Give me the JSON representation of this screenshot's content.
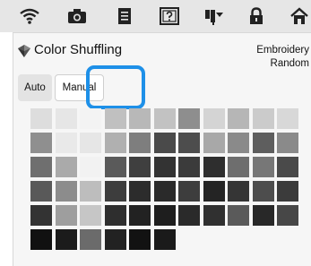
{
  "topbar": {
    "icons": [
      "wifi-icon",
      "camera-icon",
      "document-icon",
      "help-icon",
      "hoop-icon",
      "lock-icon",
      "home-icon"
    ]
  },
  "screen": {
    "title": "Color Shuffling",
    "mode_line1": "Embroidery",
    "mode_line2": "Random",
    "tabs": [
      {
        "label": "Auto",
        "selected": false
      },
      {
        "label": "Manual",
        "selected": true
      }
    ]
  },
  "palette": {
    "highlight_color": "#1e90e8",
    "rows": [
      [
        "#dddddd",
        "#e6e6e6",
        "#f3f3f3",
        "#c0c0c0",
        "#b8b8b8",
        "#c2c2c2",
        "#8e8e8e",
        "#d4d4d4",
        "#b6b6b6",
        "#cbcbcb",
        "#d8d8d8"
      ],
      [
        "#8f8f8f",
        "#e9e9e9",
        "#e6e6e6",
        "#b0b0b0",
        "#7e7e7e",
        "#4a4a4a",
        "#4d4d4d",
        "#a8a8a8",
        "#8a8a8a",
        "#5e5e5e",
        "#8a8a8a"
      ],
      [
        "#6f6f6f",
        "#aaaaaa",
        "#f2f2f2",
        "#5a5a5a",
        "#3f3f3f",
        "#333333",
        "#3b3b3b",
        "#2e2e2e",
        "#6e6e6e",
        "#777777",
        "#4a4a4a"
      ],
      [
        "#595959",
        "#8c8c8c",
        "#bdbdbd",
        "#3d3d3d",
        "#2c2c2c",
        "#2a2a2a",
        "#3d3d3d",
        "#242424",
        "#353535",
        "#4d4d4d",
        "#3b3b3b"
      ],
      [
        "#333333",
        "#9e9e9e",
        "#c6c6c6",
        "#2e2e2e",
        "#222222",
        "#1e1e1e",
        "#2a2a2a",
        "#303030",
        "#5a5a5a",
        "#282828",
        "#474747"
      ],
      [
        "#111111",
        "#1b1b1b",
        "#6b6b6b",
        "#222222",
        "#121212",
        "#1a1a1a"
      ]
    ]
  }
}
